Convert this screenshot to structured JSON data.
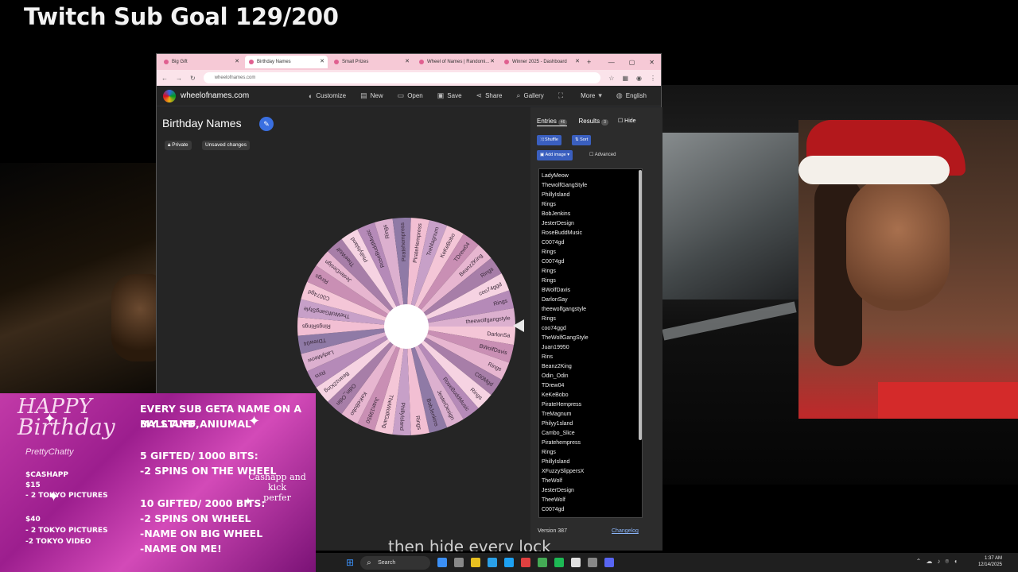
{
  "overlay": {
    "goal_title": "Twitch Sub Goal 129/200"
  },
  "browser": {
    "tabs": [
      {
        "label": "Big Gift",
        "active": false
      },
      {
        "label": "Birthday Names",
        "active": true
      },
      {
        "label": "Small Prizes",
        "active": false
      },
      {
        "label": "Wheel of Names | Randomi...",
        "active": false
      },
      {
        "label": "Winner 2025 - Dashboard",
        "active": false
      }
    ],
    "new_tab": "+",
    "url": "wheelofnames.com"
  },
  "app": {
    "site_name": "wheelofnames.com",
    "menu": [
      {
        "label": "Customize",
        "icon": "palette-icon",
        "glyph": "◐"
      },
      {
        "label": "New",
        "icon": "file-icon",
        "glyph": "▤"
      },
      {
        "label": "Open",
        "icon": "folder-icon",
        "glyph": "▭"
      },
      {
        "label": "Save",
        "icon": "save-icon",
        "glyph": "▣"
      },
      {
        "label": "Share",
        "icon": "share-icon",
        "glyph": "⋖"
      },
      {
        "label": "Gallery",
        "icon": "search-icon",
        "glyph": "⌕"
      },
      {
        "label": "",
        "icon": "fullscreen-icon",
        "glyph": "⛶"
      },
      {
        "label": "More",
        "icon": "chevron-down-icon",
        "glyph": "▾"
      },
      {
        "label": "English",
        "icon": "globe-icon",
        "glyph": "◍"
      }
    ],
    "wheel_title": "Birthday Names",
    "private_label": "Private",
    "unsaved_label": "Unsaved changes"
  },
  "sidebar": {
    "entries_tab": "Entries",
    "entries_count": "46",
    "results_tab": "Results",
    "results_count": "3",
    "hide_label": "Hide",
    "shuffle_label": "Shuffle",
    "sort_label": "Sort",
    "add_image_label": "Add image",
    "advanced_label": "Advanced",
    "entries": [
      "LadyMeow",
      "ThewolfGangStyle",
      "PhillyIsland",
      "Rings",
      "BobJenkins",
      "JesterDesign",
      "RoseBuddMusic",
      "C0074gd",
      "Rings",
      "C0074gd",
      "Rings",
      "Rings",
      "BWolfDavis",
      "DarlonSay",
      "theewolfgangstyle",
      "Rings",
      "coo74ggd",
      "TheWolfGangStyle",
      "Juan19950",
      "Rins",
      "Beanz2King",
      "Odin_Odin",
      "TDrew04",
      "KeKeBobo",
      "PirateHempress",
      "TreMagnum",
      "Philyy1sland",
      "Cambo_Slice",
      "Piratehempress",
      "Rings",
      "PhillyIsland",
      "XFuzzySlippersX",
      "TheWolf",
      "JesterDesign",
      "TheeWolf",
      "C0074gd"
    ],
    "version": "Version 387",
    "changelog": "Changelog"
  },
  "wheel": {
    "colors": [
      "#f4c6d7",
      "#c98fb4",
      "#e7b6d0",
      "#a77ea8",
      "#f6d3e2",
      "#b58ab8",
      "#dcb0cf",
      "#8f7aa6",
      "#f2bfd3",
      "#c7a0c8"
    ],
    "labels": [
      "DarlonSa",
      "BWolfDavis",
      "Rings",
      "C00Mgd",
      "Rings",
      "RoseBuddMusic",
      "JesterDesign",
      "BobJenkins",
      "Rings",
      "PhillyIsland",
      "TheWolfGang",
      "Juan19950",
      "KeKeBobo",
      "Odin_Odin",
      "Beanz2King",
      "Rins",
      "LadyMeow",
      "TDrew04",
      "RingsRings",
      "TheWolfGangStyle",
      "C0074gd",
      "Rings",
      "JesterDesign",
      "TheeWolf",
      "PhillyIsland",
      "RoseBuddMusic",
      "Rings",
      "Piratehempress",
      "PirateHempress",
      "TreMagnum",
      "KeKeBobo",
      "TDrew04",
      "Beanz2King",
      "Rings",
      "coo74ggd",
      "Rings",
      "theewolfgangstyle"
    ]
  },
  "promo": {
    "happy": "HAPPY",
    "birthday": "Birthday",
    "name": "PrettyChatty",
    "cashapp": "$CASHAPP",
    "price15": "$15",
    "tier15": "- 2 TOKYO PICTURES",
    "price40": "$40",
    "tier40a": "- 2 TOKYO PICTURES",
    "tier40b": "-2 TOKYO VIDEO",
    "headline1": "EVERY SUB GETA NAME ON A BALL AND,",
    "headline2": "MY STUFF ANIUMAL",
    "gift5a": "5 GIFTED/ 1000 BITS:",
    "gift5b": "-2 SPINS ON THE WHEEL",
    "gift10a": "10 GIFTED/ 2000 BITS:",
    "gift10b": "-2 SPINS ON WHEEL",
    "gift10c": "-NAME ON BIG WHEEL",
    "gift10d": "-NAME ON ME!",
    "cashapp_kick1": "Cashapp and kick",
    "cashapp_kick2": "perfer"
  },
  "caption": "then hide every lock",
  "taskbar": {
    "search_label": "Search",
    "time": "1:37 AM",
    "date": "12/14/2025",
    "icon_colors": [
      "#3b8ff5",
      "#888",
      "#e8c020",
      "#2aa0e8",
      "#1da1f2",
      "#e04040",
      "#44aa55",
      "#1db954",
      "#e0e0e0",
      "#888",
      "#5865f2"
    ]
  }
}
